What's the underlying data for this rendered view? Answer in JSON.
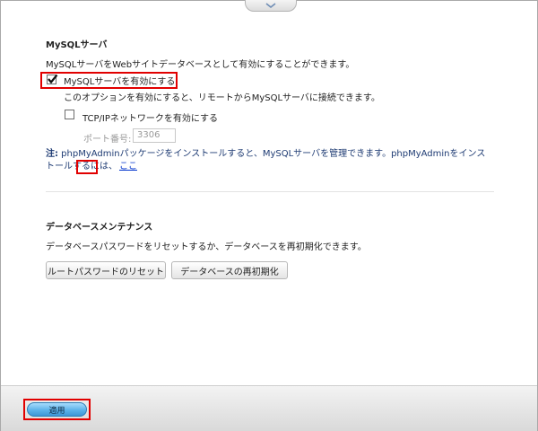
{
  "mysql": {
    "title": "MySQLサーバ",
    "description": "MySQLサーバをWebサイトデータベースとして有効にすることができます。",
    "enable_label": "MySQLサーバを有効にする",
    "enable_checked": true,
    "enable_help": "このオプションを有効にすると、リモートからMySQLサーバに接続できます。",
    "tcpip_label": "TCP/IPネットワークを有効にする",
    "tcpip_checked": false,
    "port_label": "ポート番号:",
    "port_value": "3306",
    "note_label": "注:",
    "note_text": " phpMyAdminパッケージをインストールすると、MySQLサーバを管理できます。phpMyAdminをインストールするには、",
    "note_link": "ここ"
  },
  "maintenance": {
    "title": "データベースメンテナンス",
    "description": "データベースパスワードをリセットするか、データベースを再初期化できます。",
    "reset_password_button": "ルートパスワードのリセット",
    "reinitialize_button": "データベースの再初期化"
  },
  "footer": {
    "apply_button": "適用"
  },
  "icons": {
    "collapse": "chevron-down-icon",
    "checkmark": "checkmark-icon"
  },
  "colors": {
    "highlight": "#e10000",
    "apply_button": "#5cb3ea",
    "link": "#0033cc",
    "note": "#1e3b73"
  }
}
